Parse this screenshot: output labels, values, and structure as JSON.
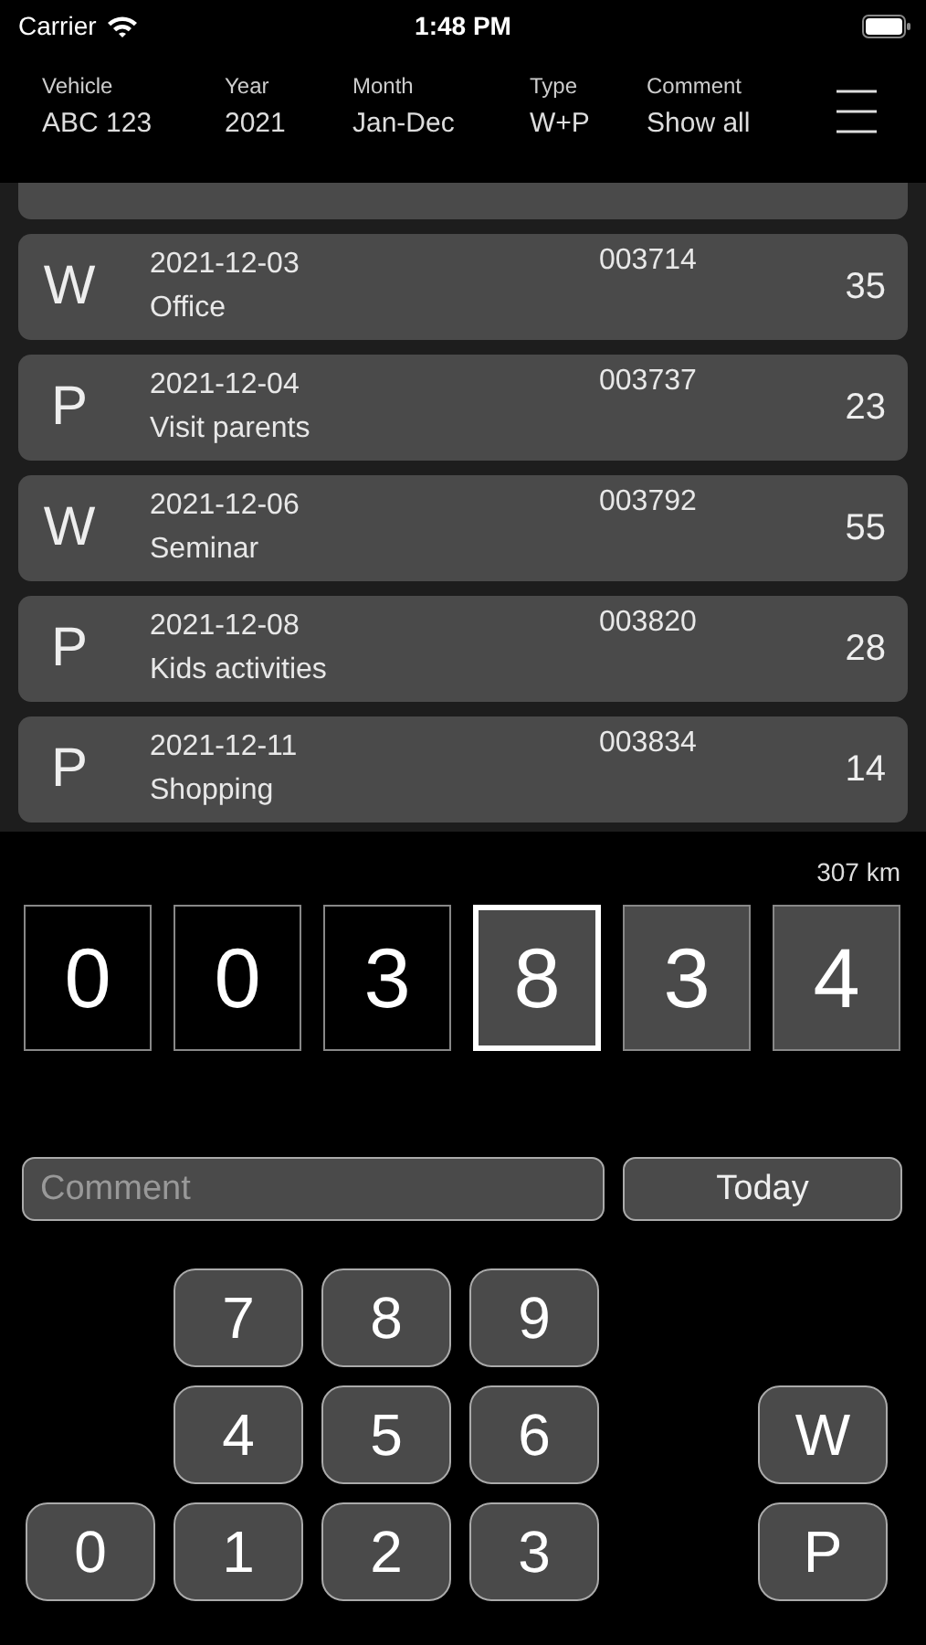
{
  "status_bar": {
    "carrier": "Carrier",
    "time": "1:48 PM"
  },
  "filters": [
    {
      "label": "Vehicle",
      "value": "ABC 123"
    },
    {
      "label": "Year",
      "value": "2021"
    },
    {
      "label": "Month",
      "value": "Jan-Dec"
    },
    {
      "label": "Type",
      "value": "W+P"
    },
    {
      "label": "Comment",
      "value": "Show all"
    }
  ],
  "trips": [
    {
      "type": "W",
      "date": "2021-12-03",
      "comment": "Office",
      "odometer": "003714",
      "distance": "35"
    },
    {
      "type": "P",
      "date": "2021-12-04",
      "comment": "Visit parents",
      "odometer": "003737",
      "distance": "23"
    },
    {
      "type": "W",
      "date": "2021-12-06",
      "comment": "Seminar",
      "odometer": "003792",
      "distance": "55"
    },
    {
      "type": "P",
      "date": "2021-12-08",
      "comment": "Kids activities",
      "odometer": "003820",
      "distance": "28"
    },
    {
      "type": "P",
      "date": "2021-12-11",
      "comment": "Shopping",
      "odometer": "003834",
      "distance": "14"
    }
  ],
  "total": "307 km",
  "digits": [
    {
      "digit": "0",
      "entered": false,
      "selected": false
    },
    {
      "digit": "0",
      "entered": false,
      "selected": false
    },
    {
      "digit": "3",
      "entered": false,
      "selected": false
    },
    {
      "digit": "8",
      "entered": true,
      "selected": true
    },
    {
      "digit": "3",
      "entered": true,
      "selected": false
    },
    {
      "digit": "4",
      "entered": true,
      "selected": false
    }
  ],
  "comment": {
    "placeholder": "Comment"
  },
  "today_button": "Today",
  "keypad": [
    [
      "7",
      "8",
      "9"
    ],
    [
      "4",
      "5",
      "6"
    ],
    [
      "1",
      "2",
      "3"
    ]
  ],
  "zero_key": "0",
  "type_buttons": [
    "W",
    "P"
  ]
}
